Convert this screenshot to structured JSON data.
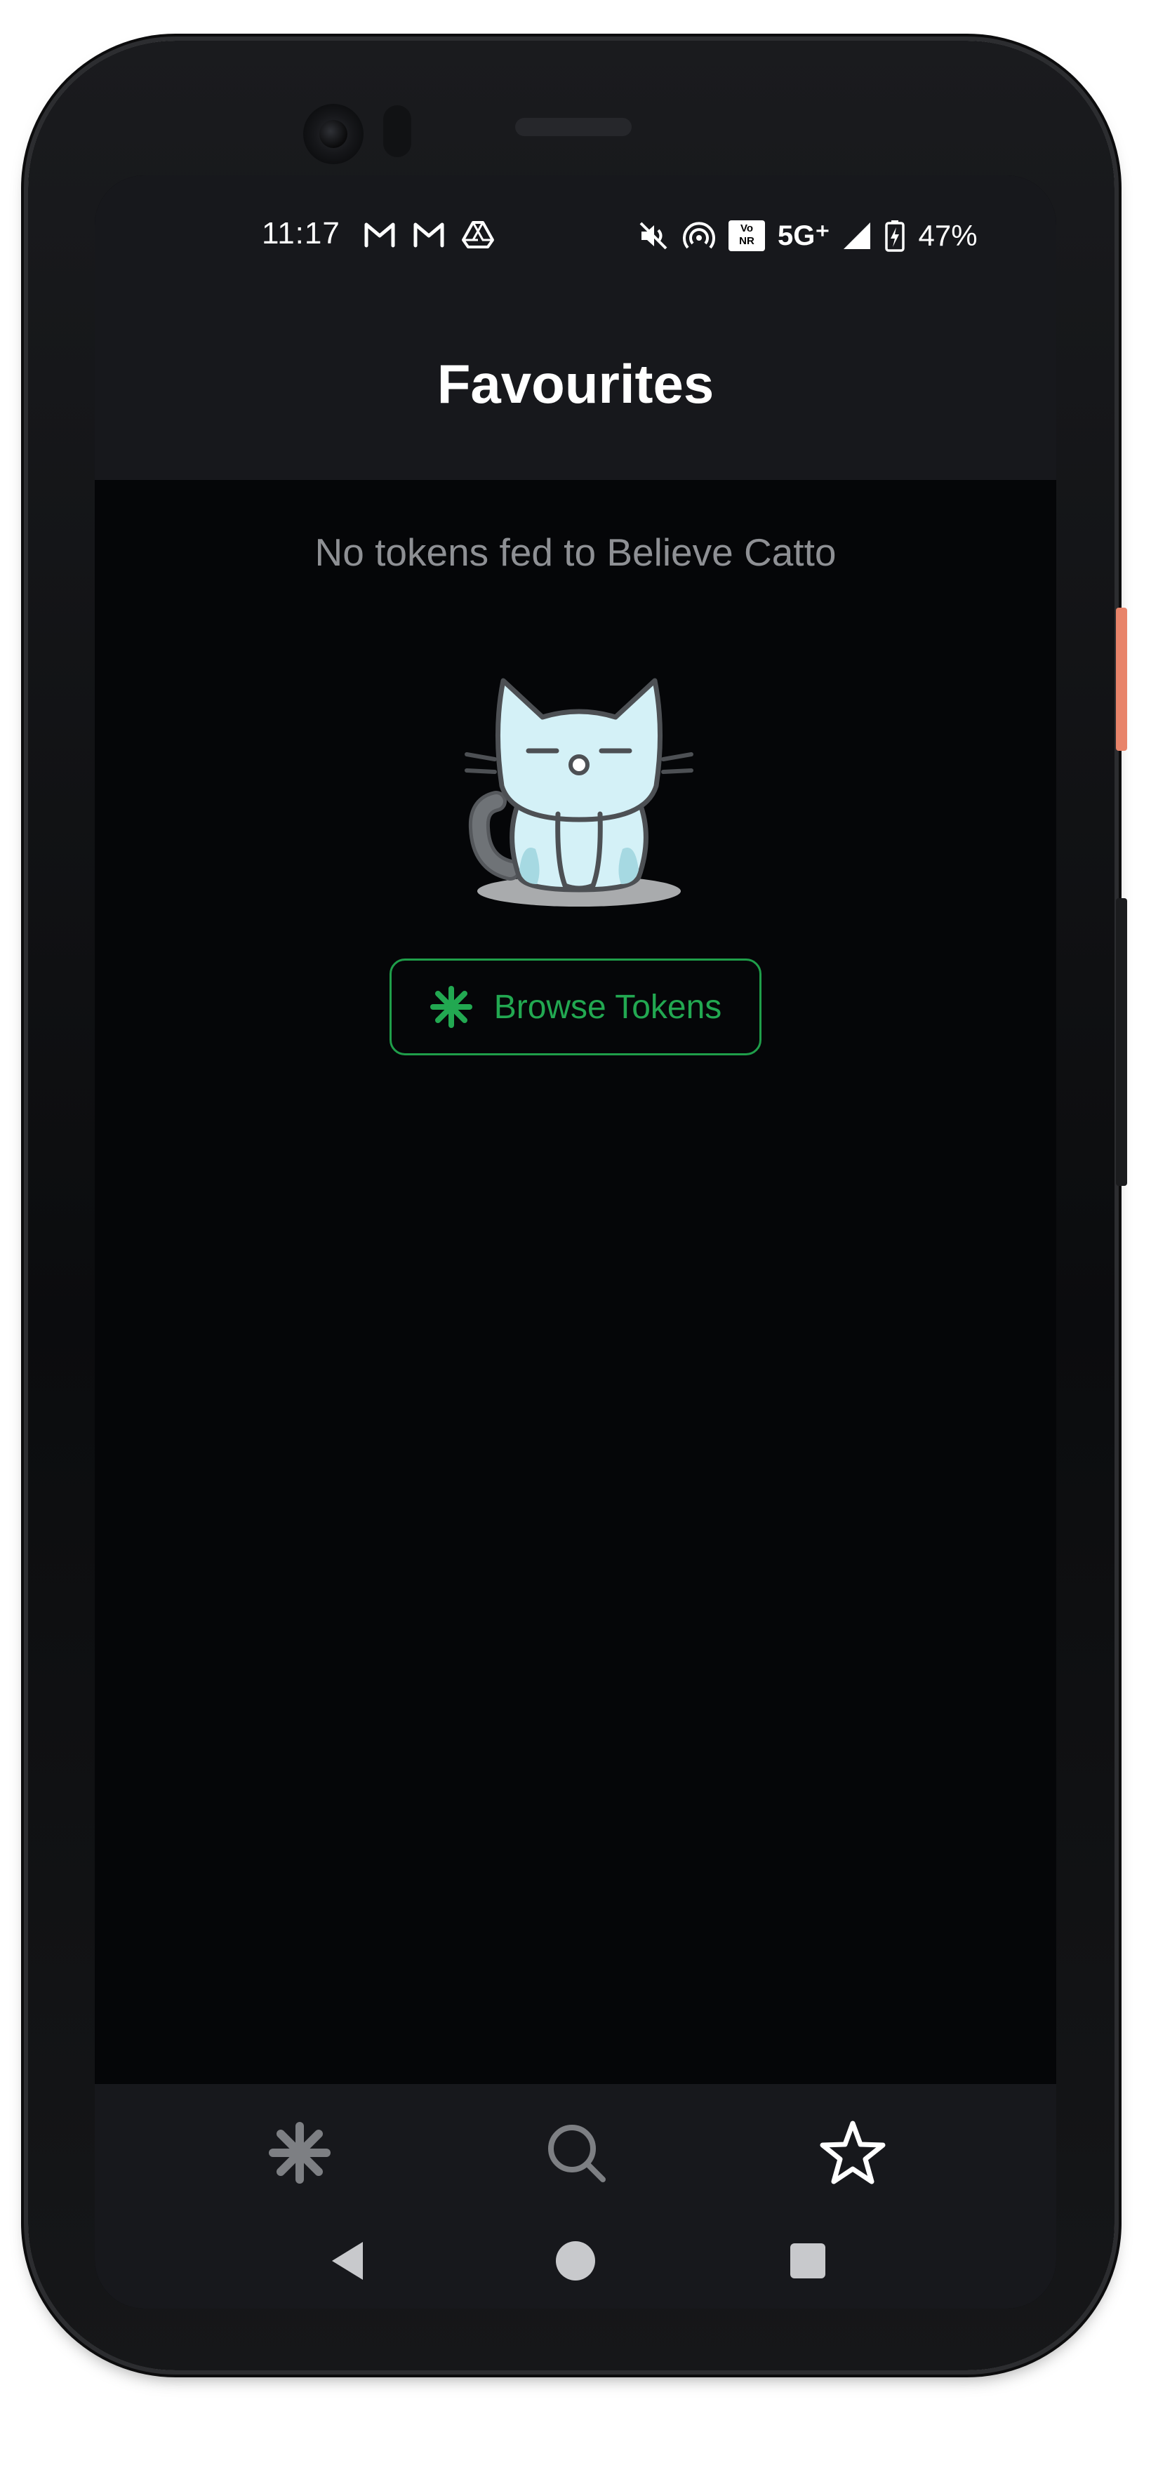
{
  "status_bar": {
    "time": "11:17",
    "left_icons": [
      "gmail-icon",
      "gmail-icon",
      "drive-icon"
    ],
    "right_icons": [
      "mute-icon",
      "hotspot-icon",
      "vonr-icon",
      "signal-icon",
      "battery-charging-icon"
    ],
    "vonr_top": "Vo",
    "vonr_bottom": "NR",
    "network": "5G⁺",
    "battery_percent": "47%"
  },
  "header": {
    "title": "Favourites"
  },
  "empty_state": {
    "message": "No tokens fed to Believe Catto",
    "illustration": "sleepy-cat-icon",
    "browse_button_label": "Browse Tokens",
    "browse_button_icon": "asterisk-icon"
  },
  "bottom_nav": {
    "items": [
      {
        "icon": "asterisk-icon",
        "active": false
      },
      {
        "icon": "search-icon",
        "active": false
      },
      {
        "icon": "star-icon",
        "active": true
      }
    ]
  },
  "system_nav": {
    "buttons": [
      "back-icon",
      "home-icon",
      "recents-icon"
    ]
  },
  "colors": {
    "background": "#050608",
    "appbar": "#17181c",
    "accent_green": "#22a851",
    "muted_text": "#8e9094",
    "inactive_icon": "#7d7f83",
    "active_icon": "#ffffff"
  }
}
